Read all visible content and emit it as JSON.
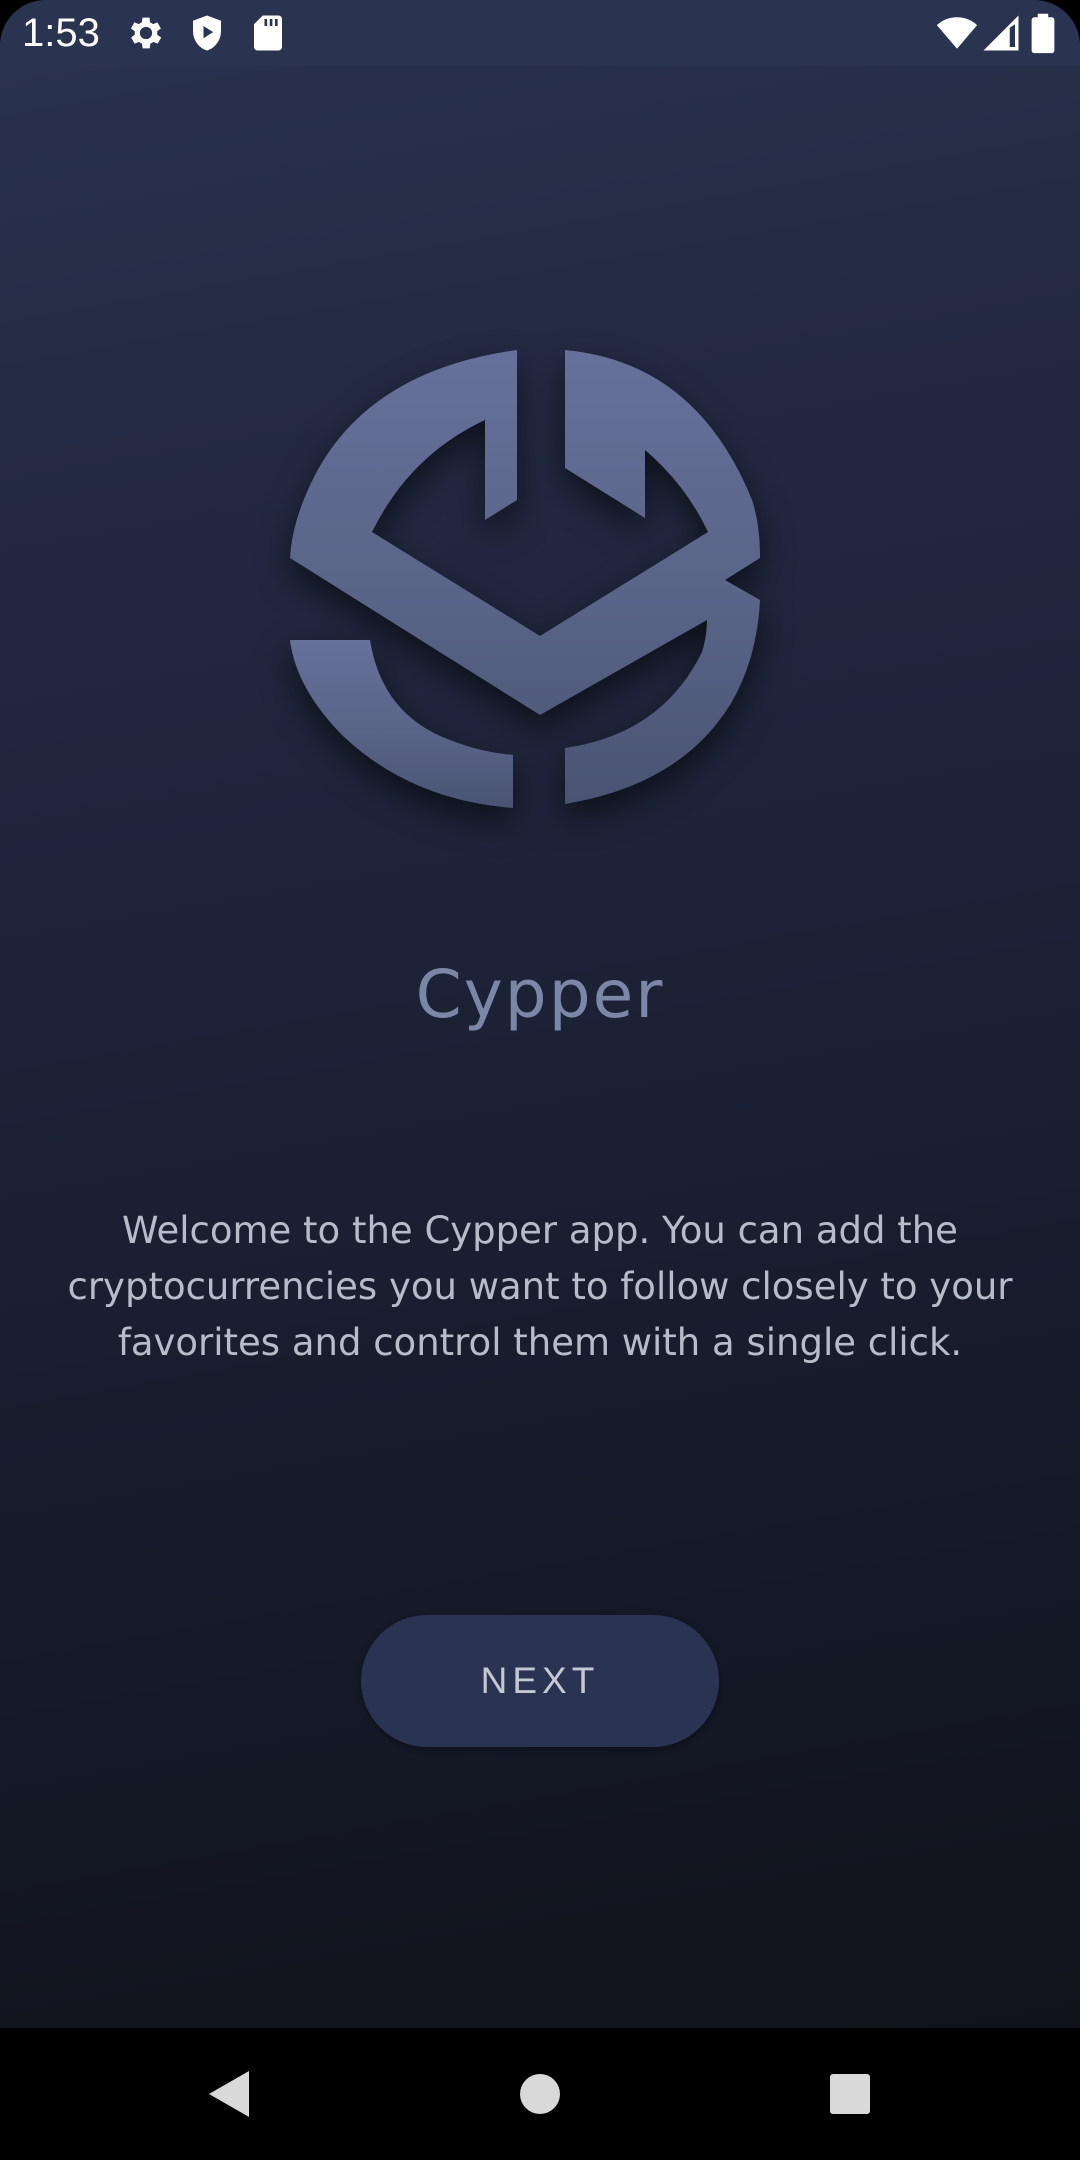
{
  "status_bar": {
    "time": "1:53",
    "icons": [
      "settings-gear-icon",
      "shield-play-icon",
      "sd-card-icon",
      "wifi-icon",
      "cell-signal-icon",
      "battery-icon"
    ]
  },
  "app": {
    "name": "Cypper",
    "logo": "cypper-logo-icon"
  },
  "welcome": {
    "text": "Welcome to the Cypper app. You can add the cryptocurrencies you want to follow closely to your favorites and control them with a single click."
  },
  "actions": {
    "next_label": "NEXT"
  },
  "nav_bar": {
    "buttons": [
      "back-triangle-icon",
      "home-circle-icon",
      "recents-square-icon"
    ]
  },
  "colors": {
    "background_top": "#2a3350",
    "background_bottom": "#0f1119",
    "logo": "#5d6788",
    "app_name": "#7c86a6",
    "text": "#b7bccb",
    "button": "#2b3352"
  }
}
